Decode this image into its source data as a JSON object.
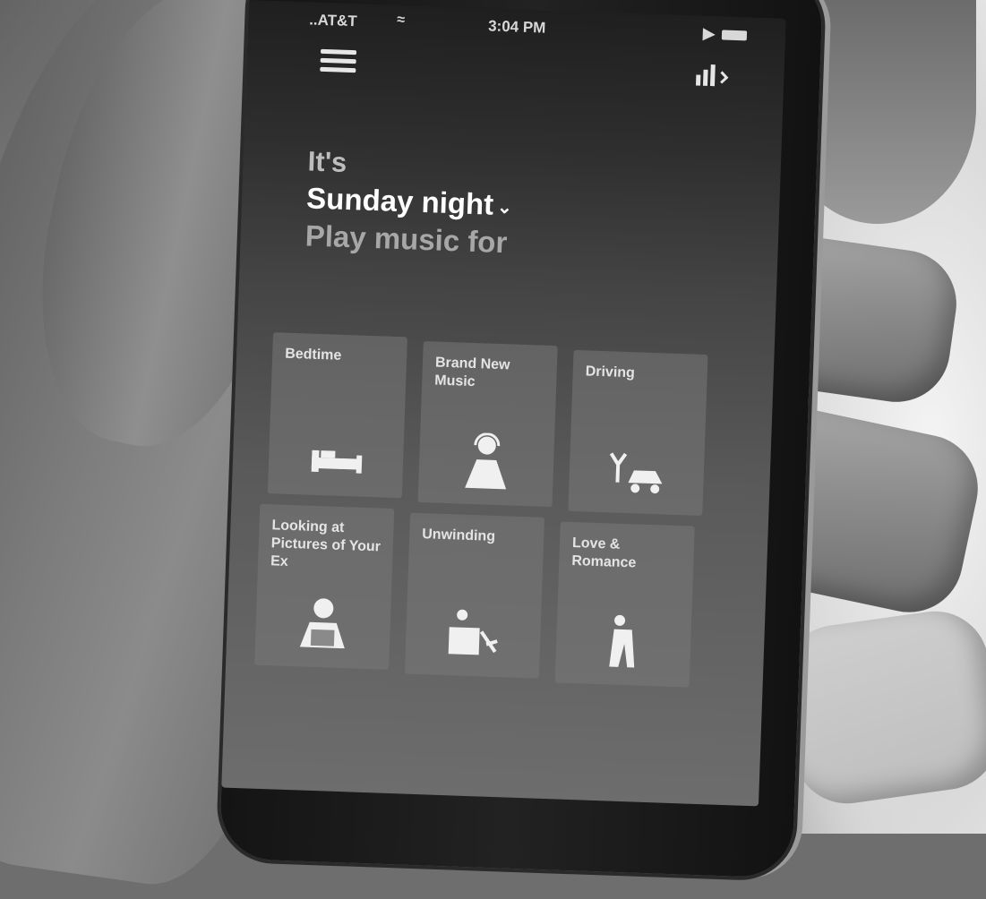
{
  "status_bar": {
    "carrier": "..AT&T",
    "time": "3:04 PM"
  },
  "header": {
    "menu_icon": "hamburger-menu-icon",
    "stats_icon": "equalizer-chevron-icon"
  },
  "headline": {
    "line1": "It's",
    "line2": "Sunday night",
    "line3": "Play music for"
  },
  "tiles": [
    {
      "label": "Bedtime",
      "icon": "bed-icon"
    },
    {
      "label": "Brand New Music",
      "icon": "headphones-person-icon"
    },
    {
      "label": "Driving",
      "icon": "car-icon"
    },
    {
      "label": "Looking at Pictures of Your Ex",
      "icon": "person-laptop-icon"
    },
    {
      "label": "Unwinding",
      "icon": "desk-relax-icon"
    },
    {
      "label": "Love & Romance",
      "icon": "couple-icon"
    }
  ]
}
